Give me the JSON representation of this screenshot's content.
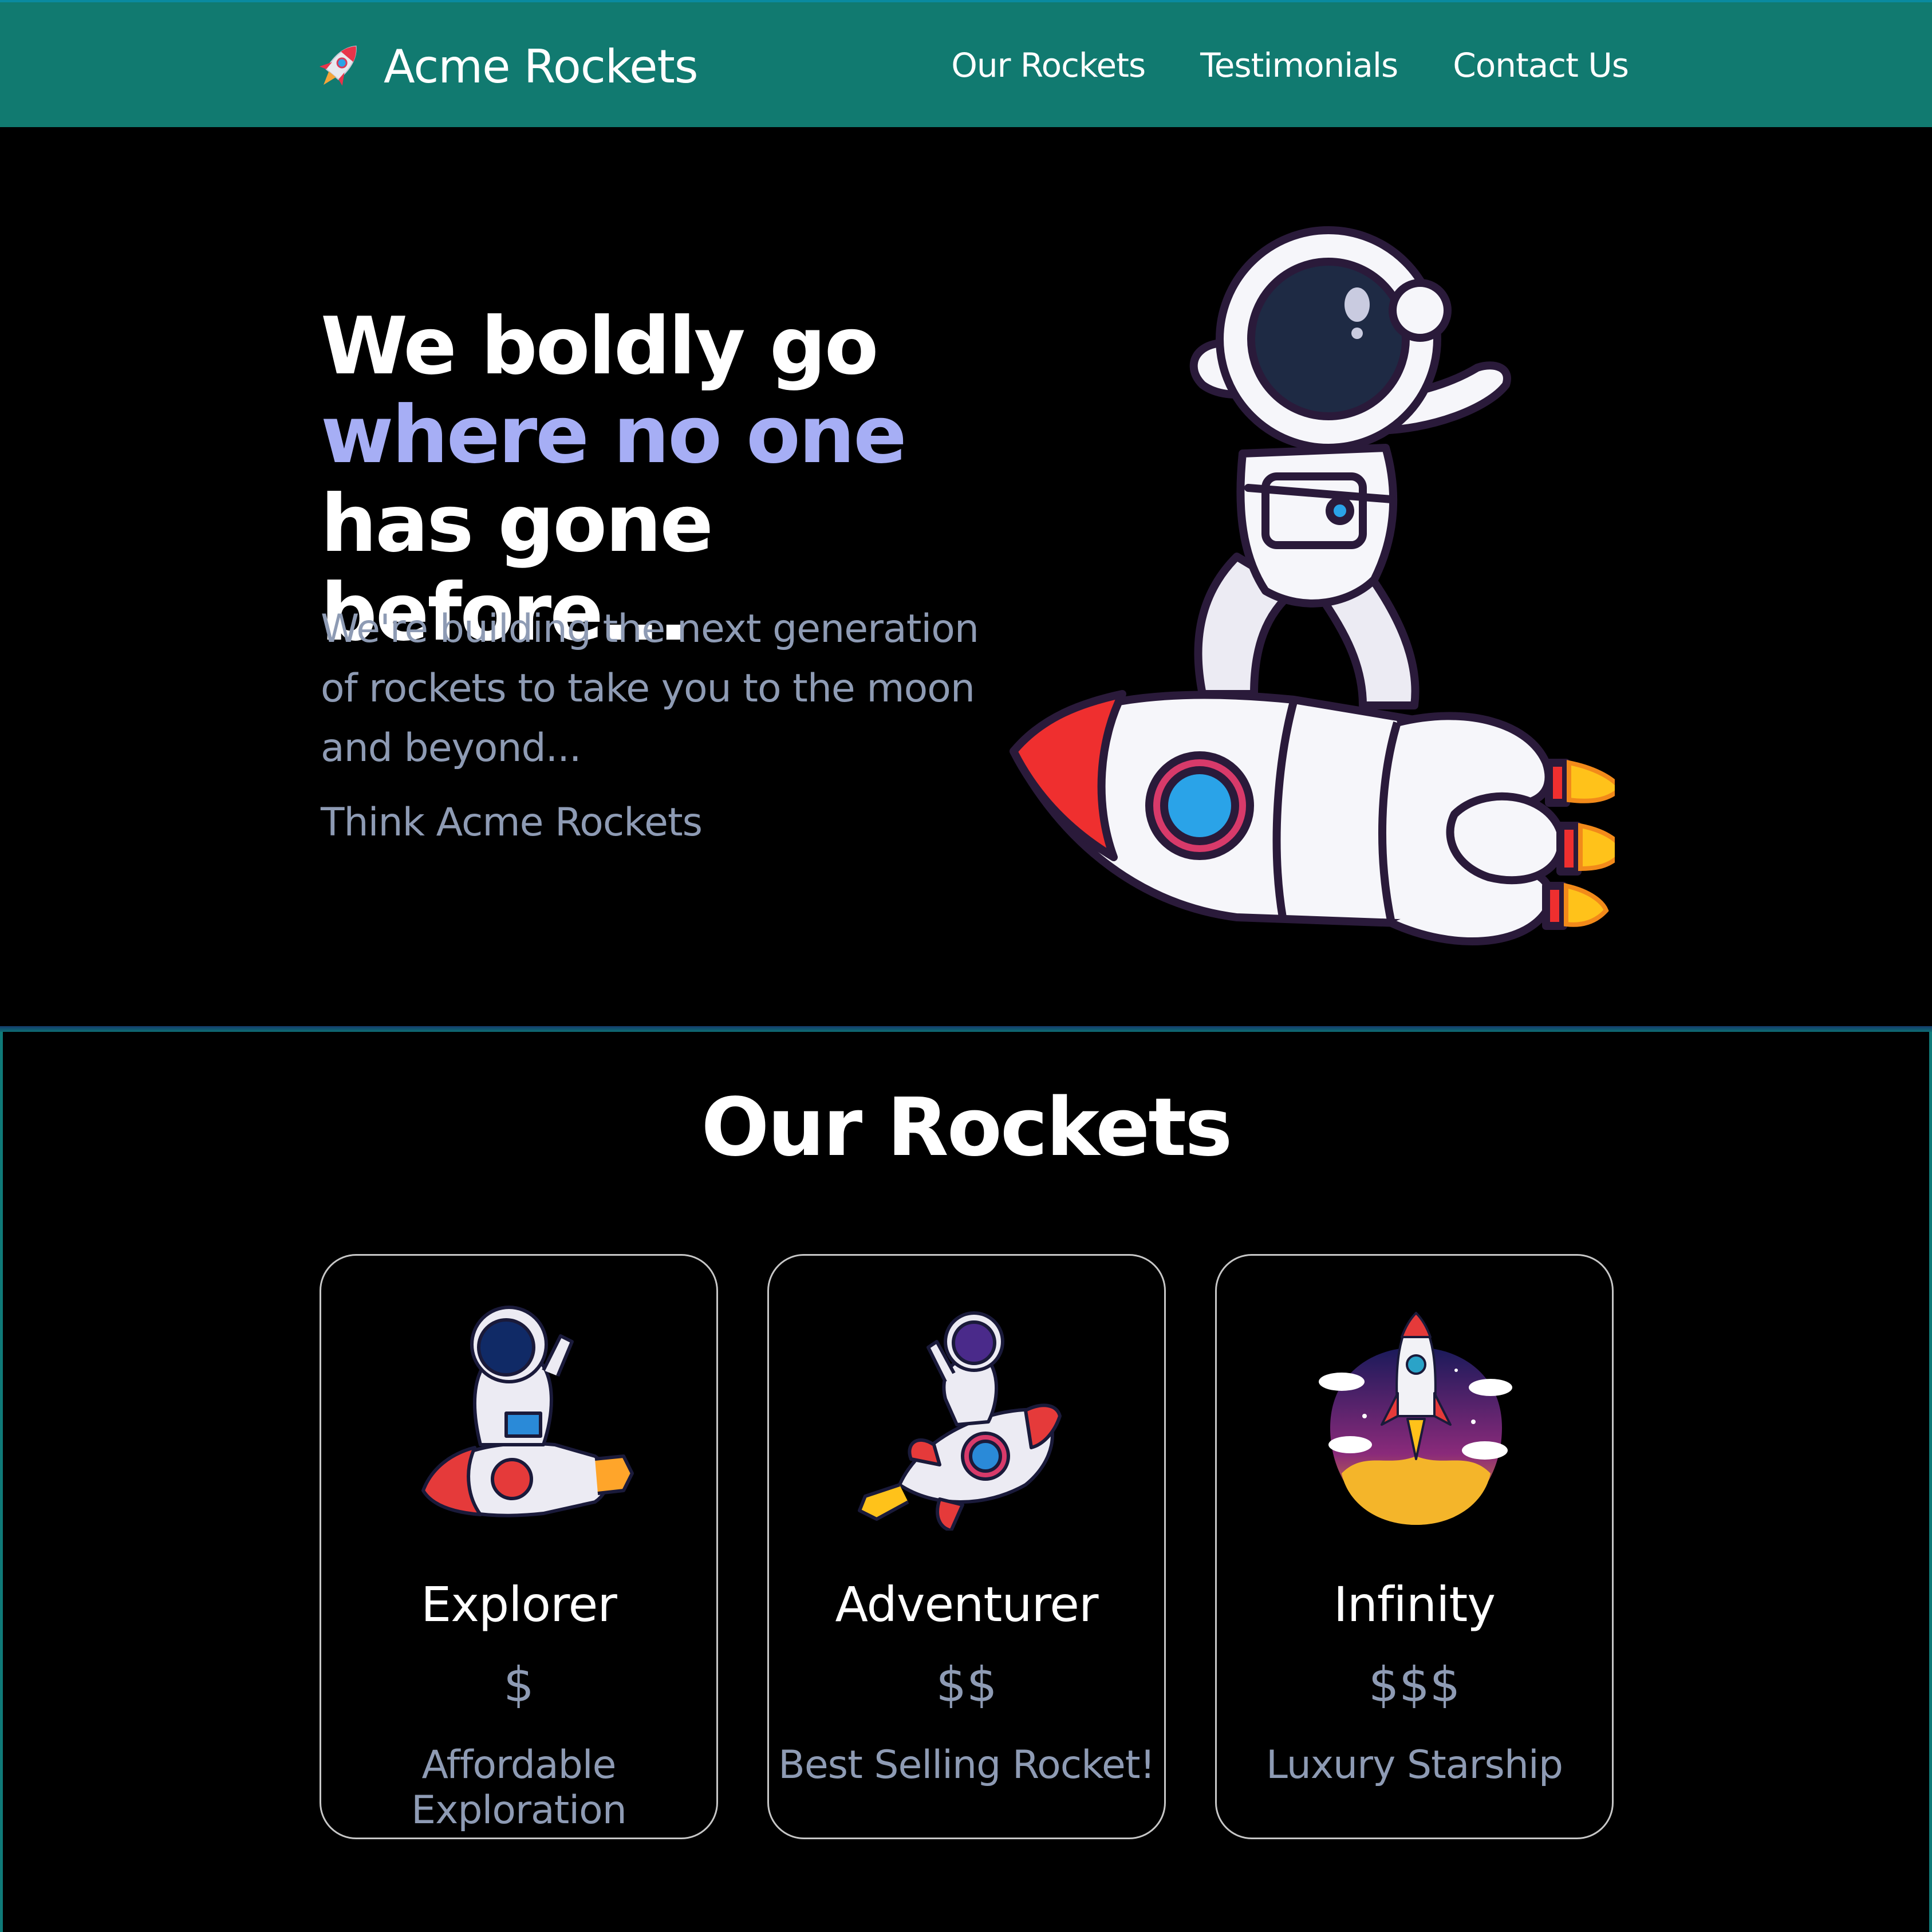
{
  "nav": {
    "brand": "Acme Rockets",
    "brand_icon": "rocket-icon",
    "links": [
      {
        "label": "Our Rockets"
      },
      {
        "label": "Testimonials"
      },
      {
        "label": "Contact Us"
      }
    ]
  },
  "hero": {
    "title_part1": "We boldly go",
    "title_accent": "where no one",
    "title_part2": " has gone before...",
    "subtitle": "We're building the next generation of rockets to take you to the moon and beyond...",
    "tagline": "Think Acme Rockets",
    "illustration": "astronaut-on-rocket-icon"
  },
  "rockets": {
    "title": "Our Rockets",
    "cards": [
      {
        "name": "Explorer",
        "price": "$",
        "tagline": "Affordable Exploration",
        "icon": "astronaut-riding-rocket-icon"
      },
      {
        "name": "Adventurer",
        "price": "$$",
        "tagline": "Best Selling Rocket!",
        "icon": "astronaut-waving-rocket-icon"
      },
      {
        "name": "Infinity",
        "price": "$$$",
        "tagline": "Luxury Starship",
        "icon": "rocket-launch-icon"
      }
    ]
  },
  "colors": {
    "navbar": "#117a70",
    "background": "#000000",
    "accent": "#a6aef5",
    "muted_text": "#8e9bb4",
    "card_border": "#c7c7c7"
  }
}
